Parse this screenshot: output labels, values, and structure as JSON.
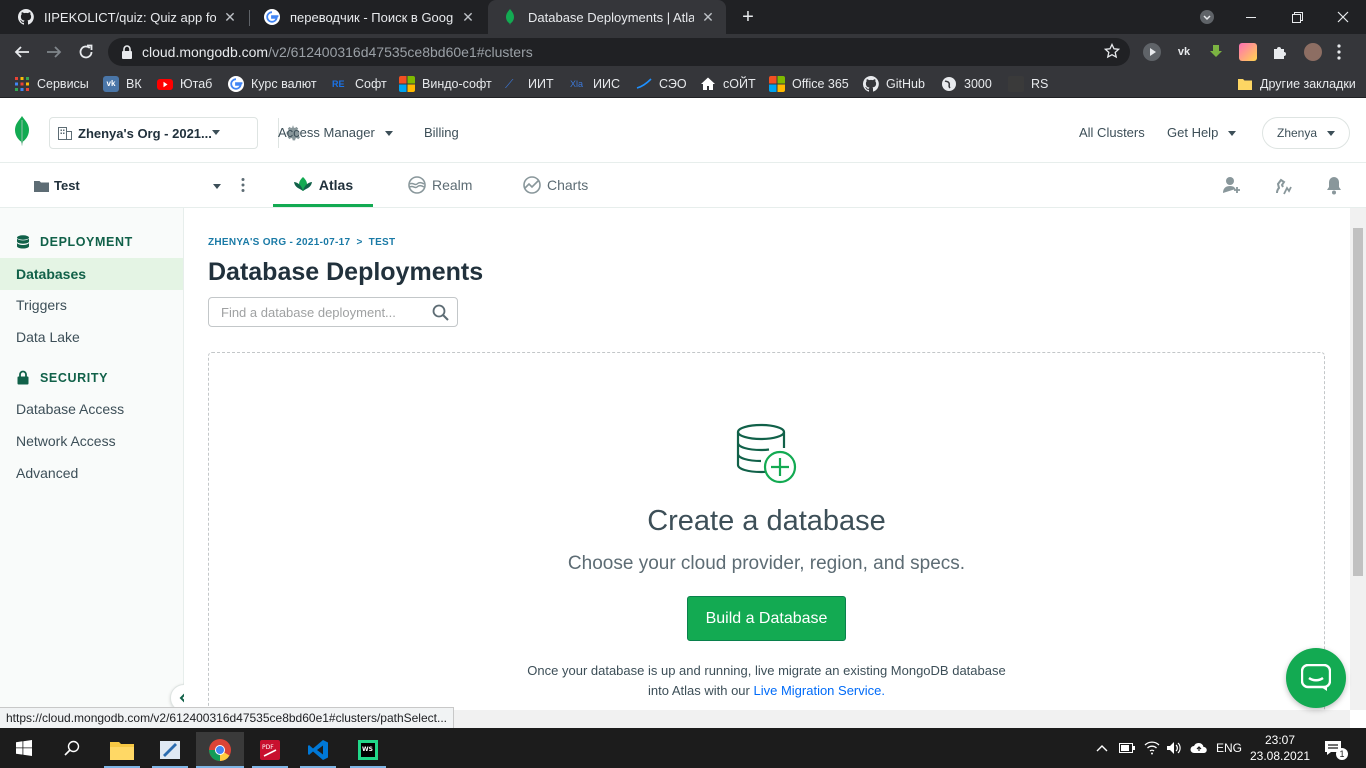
{
  "browser": {
    "tabs": [
      {
        "title": "IIPEKOLICT/quiz: Quiz app for an",
        "icon": "github-icon"
      },
      {
        "title": "переводчик - Поиск в Google",
        "icon": "google-icon"
      },
      {
        "title": "Database Deployments | Atlas: M",
        "icon": "mongodb-leaf-icon"
      }
    ],
    "url_host": "cloud.mongodb.com",
    "url_path": "/v2/612400316d47535ce8bd60e1#clusters",
    "bookmarks": [
      {
        "label": "Сервисы",
        "icon": "apps-grid-icon",
        "color": "#ea4335"
      },
      {
        "label": "ВК",
        "icon": "vk-icon",
        "color": "#4a76a8"
      },
      {
        "label": "Ютаб",
        "icon": "youtube-icon",
        "color": "#ff0000"
      },
      {
        "label": "Курс валют",
        "icon": "google-icon",
        "color": "#ffffff"
      },
      {
        "label": "Софт",
        "icon": "re-icon",
        "color": "#1a73e8"
      },
      {
        "label": "Виндо-софт",
        "icon": "windows-icon",
        "color": "#f25022"
      },
      {
        "label": "ИИТ",
        "icon": "iit-icon",
        "color": "#3c78d8"
      },
      {
        "label": "ИИС",
        "icon": "iis-icon",
        "color": "#3c78d8"
      },
      {
        "label": "СЭО",
        "icon": "seo-icon",
        "color": "#1e90ff"
      },
      {
        "label": "сОЙТ",
        "icon": "home-icon",
        "color": "#ffffff"
      },
      {
        "label": "Office 365",
        "icon": "office-icon",
        "color": "#f25022"
      },
      {
        "label": "GitHub",
        "icon": "github-icon",
        "color": "#ffffff"
      },
      {
        "label": "3000",
        "icon": "globe-icon",
        "color": "#ffffff"
      },
      {
        "label": "RS",
        "icon": "rs-icon",
        "color": "#444444"
      }
    ],
    "other_bookmarks": "Другие закладки",
    "status_url": "https://cloud.mongodb.com/v2/612400316d47535ce8bd60e1#clusters/pathSelect..."
  },
  "atlas": {
    "org_name": "Zhenya's Org - 2021...",
    "nav": {
      "access_manager": "Access Manager",
      "billing": "Billing",
      "all_clusters": "All Clusters",
      "get_help": "Get Help",
      "user": "Zhenya"
    },
    "project_name": "Test",
    "product_tabs": [
      {
        "label": "Atlas",
        "active": true
      },
      {
        "label": "Realm",
        "active": false
      },
      {
        "label": "Charts",
        "active": false
      }
    ],
    "sidebar": {
      "deployment_heading": "DEPLOYMENT",
      "deployment_items": [
        "Databases",
        "Triggers",
        "Data Lake"
      ],
      "security_heading": "SECURITY",
      "security_items": [
        "Database Access",
        "Network Access",
        "Advanced"
      ]
    },
    "breadcrumb": {
      "org": "ZHENYA'S ORG - 2021-07-17",
      "sep": ">",
      "project": "TEST"
    },
    "page_title": "Database Deployments",
    "search_placeholder": "Find a database deployment...",
    "empty_state": {
      "title": "Create a database",
      "subtitle": "Choose your cloud provider, region, and specs.",
      "button": "Build a Database",
      "migrate_line1": "Once your database is up and running, live migrate an existing MongoDB database",
      "migrate_line2_prefix": "into Atlas with our ",
      "migrate_link": "Live Migration Service",
      "migrate_line2_suffix": "."
    },
    "colors": {
      "brand_green": "#13aa52",
      "dark_green": "#116149",
      "link_blue": "#016bf8"
    }
  },
  "taskbar": {
    "language": "ENG",
    "time": "23:07",
    "date": "23.08.2021",
    "notification_count": "1"
  }
}
